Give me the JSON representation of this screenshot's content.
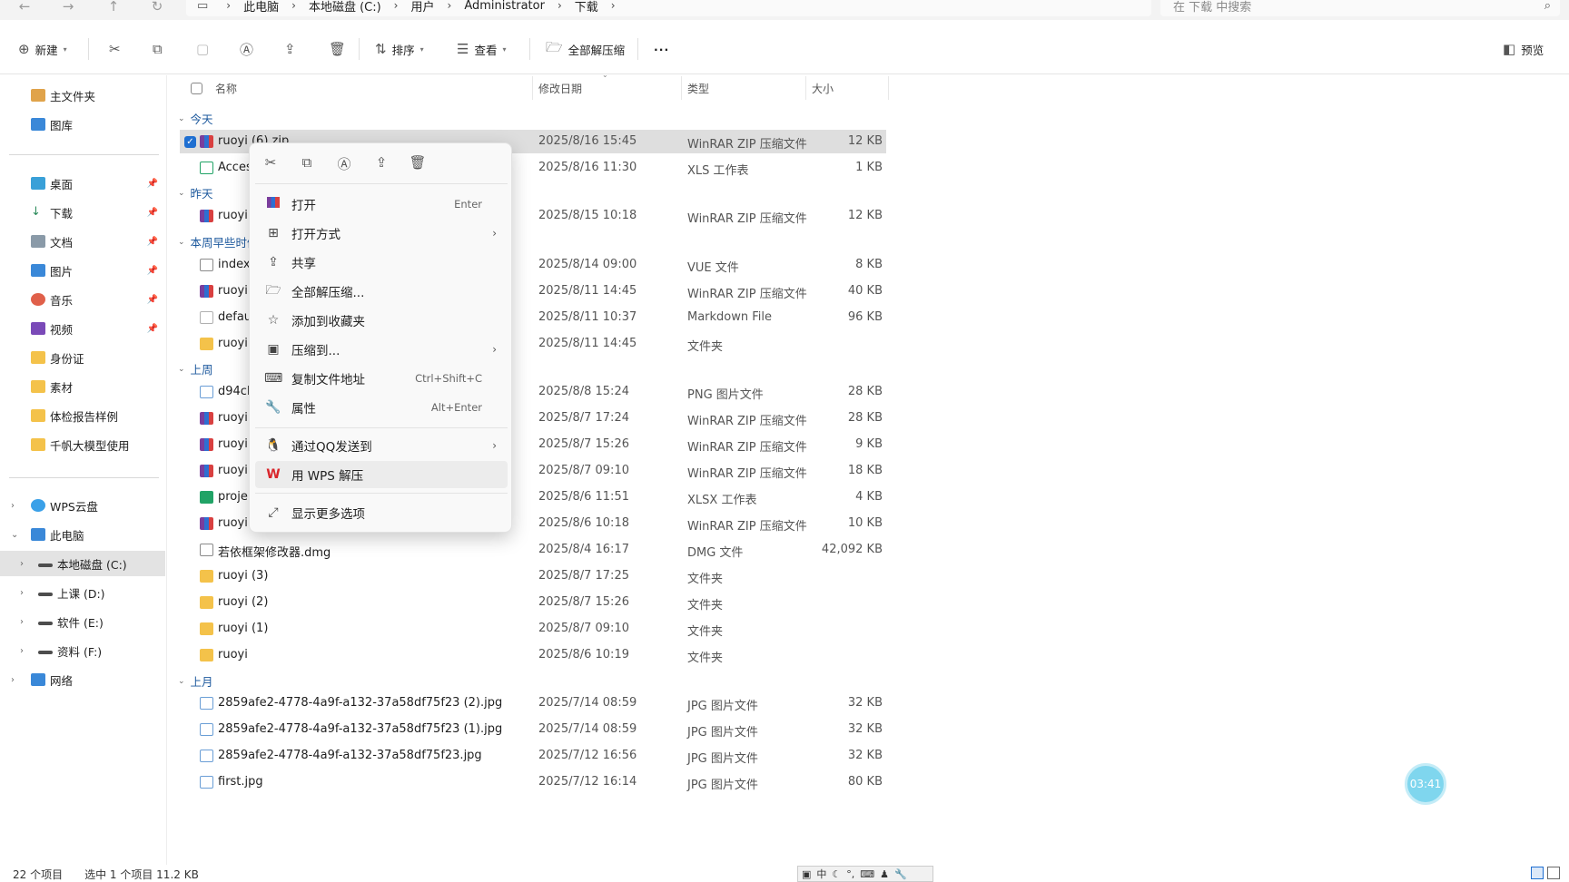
{
  "breadcrumb": [
    "此电脑",
    "本地磁盘 (C:)",
    "用户",
    "Administrator",
    "下载"
  ],
  "search": {
    "placeholder": "在 下载 中搜索"
  },
  "toolbar": {
    "new_label": "新建",
    "sort_label": "排序",
    "view_label": "查看",
    "extract_all_label": "全部解压缩",
    "more_label": "···",
    "preview_label": "预览"
  },
  "sidebar": {
    "quick": [
      {
        "label": "主文件夹"
      },
      {
        "label": "图库"
      }
    ],
    "pinned": [
      {
        "label": "桌面"
      },
      {
        "label": "下载"
      },
      {
        "label": "文档"
      },
      {
        "label": "图片"
      },
      {
        "label": "音乐"
      },
      {
        "label": "视频"
      },
      {
        "label": "身份证"
      },
      {
        "label": "素材"
      },
      {
        "label": "体检报告样例"
      },
      {
        "label": "千帆大模型使用"
      }
    ],
    "tree": [
      {
        "label": "WPS云盘"
      },
      {
        "label": "此电脑"
      },
      {
        "label": "本地磁盘 (C:)"
      },
      {
        "label": "上课 (D:)"
      },
      {
        "label": "软件 (E:)"
      },
      {
        "label": "资料 (F:)"
      },
      {
        "label": "网络"
      }
    ]
  },
  "columns": {
    "name": "名称",
    "date": "修改日期",
    "type": "类型",
    "size": "大小"
  },
  "groups": {
    "today": "今天",
    "yesterday": "昨天",
    "earlier_week": "本周早些时候",
    "last_week": "上周",
    "last_month": "上月"
  },
  "files": [
    {
      "name": "ruoyi (6).zip",
      "date": "2025/8/16 15:45",
      "type": "WinRAR ZIP 压缩文件",
      "size": "12 KB"
    },
    {
      "name": "Acces",
      "date": "2025/8/16 11:30",
      "type": "XLS 工作表",
      "size": "1 KB"
    },
    {
      "name": "ruoyi",
      "date": "2025/8/15 10:18",
      "type": "WinRAR ZIP 压缩文件",
      "size": "12 KB"
    },
    {
      "name": "index",
      "date": "2025/8/14 09:00",
      "type": "VUE 文件",
      "size": "8 KB"
    },
    {
      "name": "ruoyi",
      "date": "2025/8/11 14:45",
      "type": "WinRAR ZIP 压缩文件",
      "size": "40 KB"
    },
    {
      "name": "defau",
      "date": "2025/8/11 10:37",
      "type": "Markdown File",
      "size": "96 KB"
    },
    {
      "name": "ruoyi",
      "date": "2025/8/11 14:45",
      "type": "文件夹",
      "size": ""
    },
    {
      "name": "d94cb",
      "date": "2025/8/8 15:24",
      "type": "PNG 图片文件",
      "size": "28 KB"
    },
    {
      "name": "ruoyi",
      "date": "2025/8/7 17:24",
      "type": "WinRAR ZIP 压缩文件",
      "size": "28 KB"
    },
    {
      "name": "ruoyi",
      "date": "2025/8/7 15:26",
      "type": "WinRAR ZIP 压缩文件",
      "size": "9 KB"
    },
    {
      "name": "ruoyi",
      "date": "2025/8/7 09:10",
      "type": "WinRAR ZIP 压缩文件",
      "size": "18 KB"
    },
    {
      "name": "proje",
      "date": "2025/8/6 11:51",
      "type": "XLSX 工作表",
      "size": "4 KB"
    },
    {
      "name": "ruoyi.",
      "date": "2025/8/6 10:18",
      "type": "WinRAR ZIP 压缩文件",
      "size": "10 KB"
    },
    {
      "name": "若依框架修改器.dmg",
      "date": "2025/8/4 16:17",
      "type": "DMG 文件",
      "size": "42,092 KB"
    },
    {
      "name": "ruoyi (3)",
      "date": "2025/8/7 17:25",
      "type": "文件夹",
      "size": ""
    },
    {
      "name": "ruoyi (2)",
      "date": "2025/8/7 15:26",
      "type": "文件夹",
      "size": ""
    },
    {
      "name": "ruoyi (1)",
      "date": "2025/8/7 09:10",
      "type": "文件夹",
      "size": ""
    },
    {
      "name": "ruoyi",
      "date": "2025/8/6 10:19",
      "type": "文件夹",
      "size": ""
    },
    {
      "name": "2859afe2-4778-4a9f-a132-37a58df75f23 (2).jpg",
      "date": "2025/7/14 08:59",
      "type": "JPG 图片文件",
      "size": "32 KB"
    },
    {
      "name": "2859afe2-4778-4a9f-a132-37a58df75f23 (1).jpg",
      "date": "2025/7/14 08:59",
      "type": "JPG 图片文件",
      "size": "32 KB"
    },
    {
      "name": "2859afe2-4778-4a9f-a132-37a58df75f23.jpg",
      "date": "2025/7/12 16:56",
      "type": "JPG 图片文件",
      "size": "32 KB"
    },
    {
      "name": "first.jpg",
      "date": "2025/7/12 16:14",
      "type": "JPG 图片文件",
      "size": "80 KB"
    }
  ],
  "context_menu": {
    "items": [
      {
        "label": "打开",
        "accel": "Enter"
      },
      {
        "label": "打开方式",
        "accel": ""
      },
      {
        "label": "共享",
        "accel": ""
      },
      {
        "label": "全部解压缩...",
        "accel": ""
      },
      {
        "label": "添加到收藏夹",
        "accel": ""
      },
      {
        "label": "压缩到...",
        "accel": ""
      },
      {
        "label": "复制文件地址",
        "accel": "Ctrl+Shift+C"
      },
      {
        "label": "属性",
        "accel": "Alt+Enter"
      },
      {
        "label": "通过QQ发送到",
        "accel": ""
      },
      {
        "label": "用 WPS 解压",
        "accel": ""
      },
      {
        "label": "显示更多选项",
        "accel": ""
      }
    ]
  },
  "status": {
    "item_count": "22 个项目",
    "selection": "选中 1 个项目  11.2 KB"
  },
  "ime": {
    "lang": "中"
  },
  "timer": "03:41"
}
